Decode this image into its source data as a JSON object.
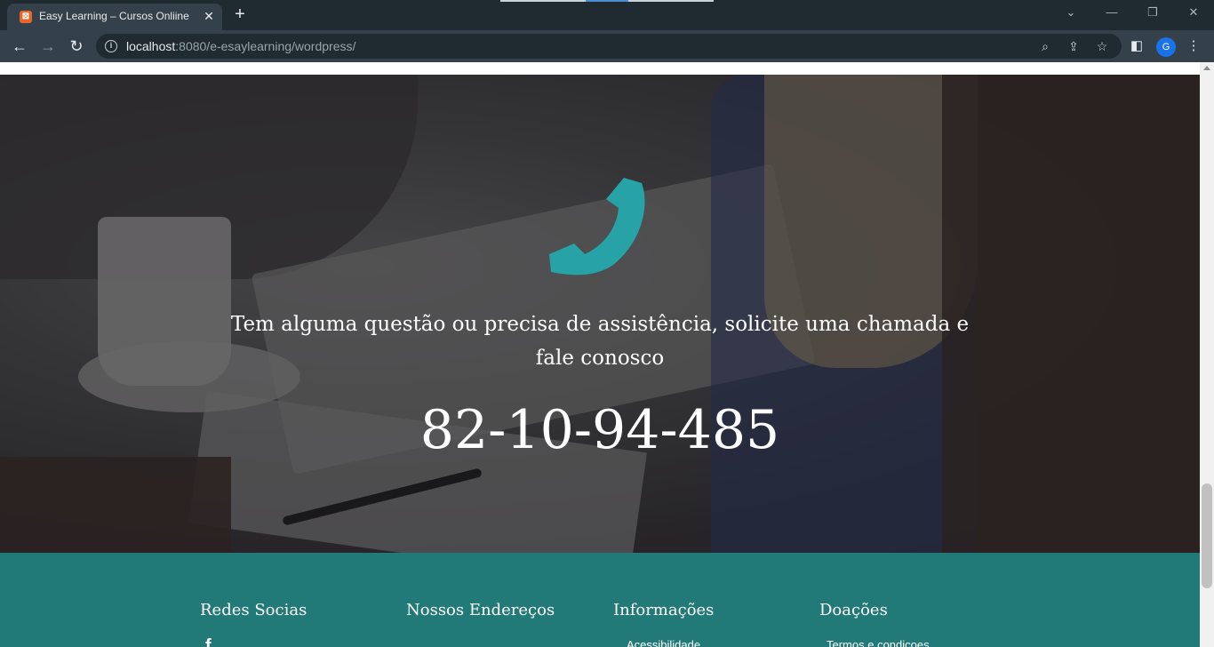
{
  "browser": {
    "tab_title": "Easy Learning – Cursos Onliine",
    "url_host": "localhost",
    "url_rest": ":8080/e-esaylearning/wordpress/",
    "profile_initial": "G"
  },
  "hero": {
    "message": "Tem alguma questão ou precisa de assistência, solicite uma chamada e fale conosco",
    "phone_number": "82-10-94-485",
    "accent_color": "#27a3a8"
  },
  "footer": {
    "background_color": "#227a78",
    "columns": [
      {
        "title": "Redes Socias",
        "first_item": "f"
      },
      {
        "title": "Nossos Endereços",
        "first_item": ""
      },
      {
        "title": "Informações",
        "first_item": "Acessibilidade"
      },
      {
        "title": "Doações",
        "first_item": "Termos e condiçoes"
      }
    ]
  }
}
